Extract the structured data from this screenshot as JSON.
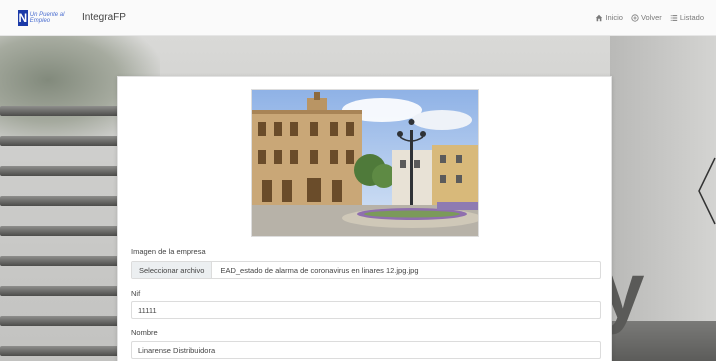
{
  "header": {
    "logo_text": "Un Puente al Empleo",
    "brand_name": "IntegraFP",
    "nav": [
      {
        "icon": "home-icon",
        "label": "Inicio"
      },
      {
        "icon": "plus-circle-icon",
        "label": "Volver"
      },
      {
        "icon": "list-icon",
        "label": "Listado"
      }
    ]
  },
  "form": {
    "image_label": "Imagen de la empresa",
    "file_button": "Seleccionar archivo",
    "file_name": "EAD_estado de alarma de coronavirus en linares 12.jpg.jpg",
    "nif_label": "Nif",
    "nif_value": "11111",
    "nombre_label": "Nombre",
    "nombre_value": "Linarense Distribuidora"
  },
  "colors": {
    "brand_blue": "#1b3aa8",
    "nav_text": "#7a7a7a"
  }
}
